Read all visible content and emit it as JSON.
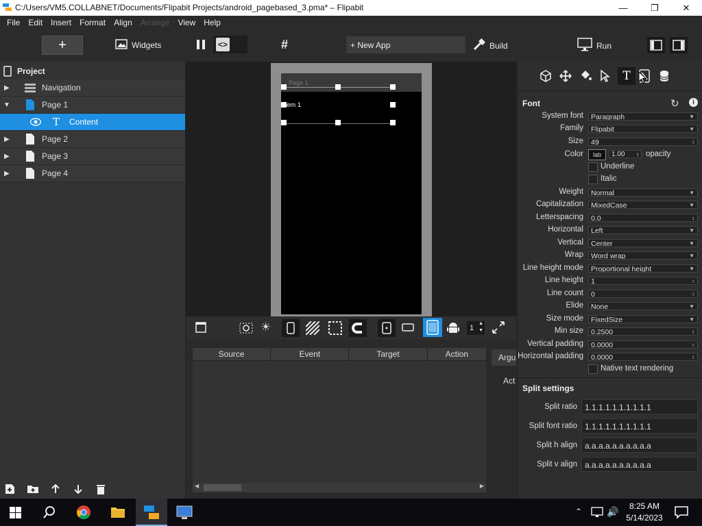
{
  "window": {
    "title": "C:/Users/VM5.COLLABNET/Documents/Flipabit Projects/android_pagebased_3.pma* – Flipabit"
  },
  "menu": [
    "File",
    "Edit",
    "Insert",
    "Format",
    "Align",
    "Arrange",
    "View",
    "Help"
  ],
  "toolbar": {
    "widgets": "Widgets",
    "new_app": "+ New App",
    "build": "Build",
    "run": "Run"
  },
  "project": {
    "header": "Project",
    "items": [
      {
        "label": "Navigation"
      },
      {
        "label": "Page 1"
      },
      {
        "label": "Content"
      },
      {
        "label": "Page 2"
      },
      {
        "label": "Page 3"
      },
      {
        "label": "Page 4"
      }
    ]
  },
  "canvas": {
    "page_label": "Page 1",
    "item_text": "em 1",
    "zoom_value": "1"
  },
  "events_table": {
    "columns": [
      "Source",
      "Event",
      "Target",
      "Action"
    ],
    "tab": "Argu",
    "act_label": "Act"
  },
  "font_panel": {
    "header": "Font",
    "system_font_label": "System font",
    "system_font": "Paragraph",
    "family_label": "Family",
    "family": "Flipabit",
    "size_label": "Size",
    "size": "49",
    "color_label": "Color",
    "color_btn": "lab",
    "color_opacity_value": "1.00",
    "opacity_label": "opacity",
    "underline_label": "Underline",
    "italic_label": "Italic",
    "weight_label": "Weight",
    "weight": "Normal",
    "cap_label": "Capitalization",
    "cap": "MixedCase",
    "letterspacing_label": "Letterspacing",
    "letterspacing": "0.0",
    "horizontal_label": "Horizontal",
    "horizontal": "Left",
    "vertical_label": "Vertical",
    "vertical": "Center",
    "wrap_label": "Wrap",
    "wrap": "Word wrap",
    "lhmode_label": "Line height mode",
    "lhmode": "Proportional height",
    "lineheight_label": "Line height",
    "lineheight": "1",
    "linecount_label": "Line count",
    "linecount": "0",
    "elide_label": "Elide",
    "elide": "None",
    "sizemode_label": "Size mode",
    "sizemode": "FixedSize",
    "minsize_label": "Min size",
    "minsize": "0.2500",
    "vpad_label": "Vertical padding",
    "vpad": "0.0000",
    "hpad_label": "Horizontal padding",
    "hpad": "0.0000",
    "native_label": "Native text rendering"
  },
  "split_settings": {
    "header": "Split settings",
    "ratio_label": "Split ratio",
    "ratio": "1.1.1.1.1.1.1.1.1.1",
    "font_ratio_label": "Split font ratio",
    "font_ratio": "1.1.1.1.1.1.1.1.1.1",
    "h_align_label": "Split h align",
    "h_align": "a.a.a.a.a.a.a.a.a.a",
    "v_align_label": "Split v align",
    "v_align": "a.a.a.a.a.a.a.a.a.a"
  },
  "taskbar": {
    "time": "8:25 AM",
    "date": "5/14/2023"
  },
  "colors": {
    "selection": "#1e8fe1",
    "panel": "#333333",
    "accent_blue": "#1e8fe1"
  }
}
